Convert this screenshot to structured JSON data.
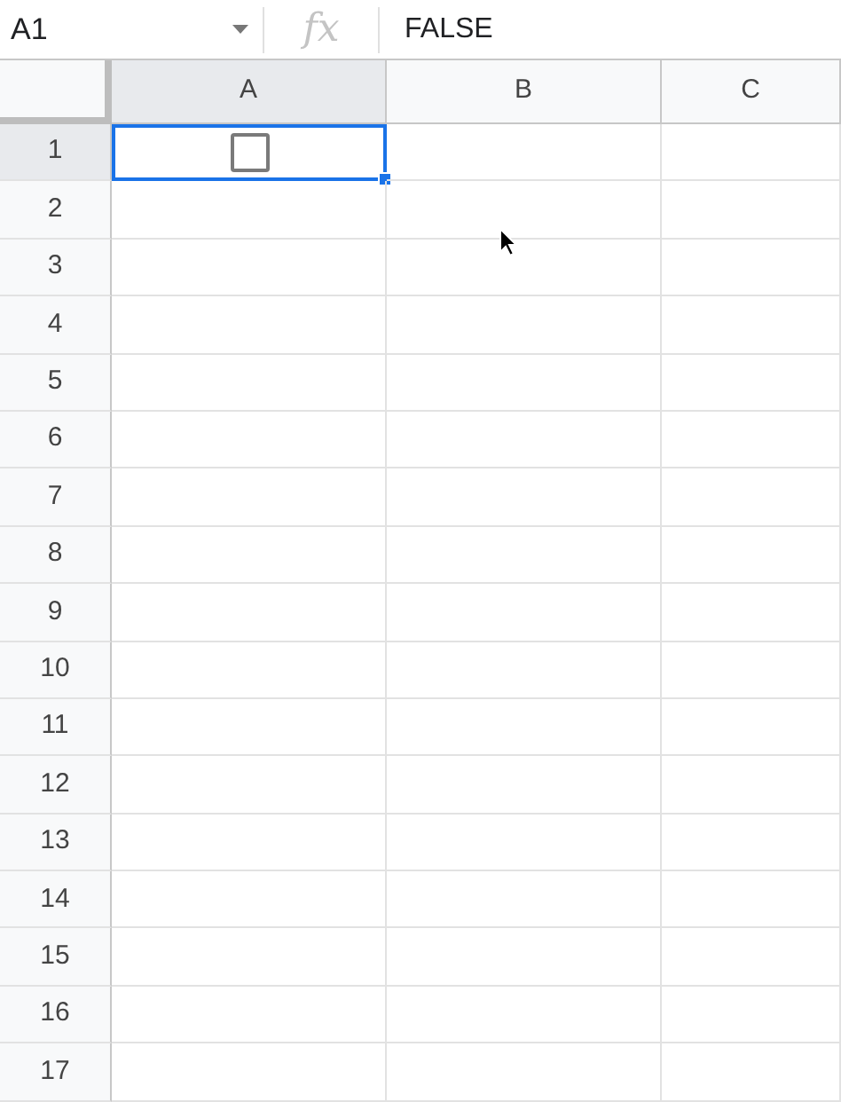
{
  "formula_bar": {
    "name_box": "A1",
    "function_label": "fx",
    "value": "FALSE"
  },
  "columns": [
    {
      "label": "A",
      "selected": true
    },
    {
      "label": "B",
      "selected": false
    },
    {
      "label": "C",
      "selected": false
    }
  ],
  "rows": [
    {
      "label": "1",
      "selected": true,
      "cells": [
        {
          "kind": "checkbox",
          "checked": false,
          "selected": true
        }
      ]
    },
    {
      "label": "2",
      "selected": false
    },
    {
      "label": "3",
      "selected": false
    },
    {
      "label": "4",
      "selected": false
    },
    {
      "label": "5",
      "selected": false
    },
    {
      "label": "6",
      "selected": false
    },
    {
      "label": "7",
      "selected": false
    },
    {
      "label": "8",
      "selected": false
    },
    {
      "label": "9",
      "selected": false
    },
    {
      "label": "10",
      "selected": false
    },
    {
      "label": "11",
      "selected": false
    },
    {
      "label": "12",
      "selected": false
    },
    {
      "label": "13",
      "selected": false
    },
    {
      "label": "14",
      "selected": false
    },
    {
      "label": "15",
      "selected": false
    },
    {
      "label": "16",
      "selected": false
    },
    {
      "label": "17",
      "selected": false
    }
  ]
}
